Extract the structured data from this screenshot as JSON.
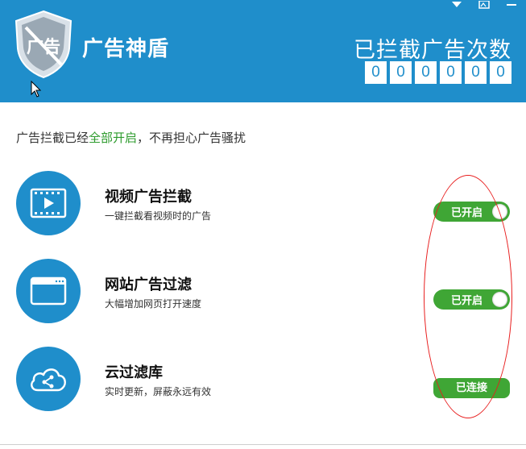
{
  "header": {
    "logo_text": "广告",
    "title": "广告神盾",
    "counter_label": "已拦截广告次数",
    "counter_digits": [
      "0",
      "0",
      "0",
      "0",
      "0",
      "0"
    ],
    "background_color": "#1f8ecb"
  },
  "window_controls": {
    "icons": [
      "chevron-down-icon",
      "skin-icon",
      "minimize-icon"
    ]
  },
  "status": {
    "prefix": "广告拦截已经",
    "highlight": "全部开启",
    "suffix": "，不再担心广告骚扰",
    "highlight_color": "#2d9b2d"
  },
  "features": [
    {
      "icon": "video-icon",
      "title": "视频广告拦截",
      "desc": "一键拦截看视频时的广告",
      "control": "toggle",
      "control_label": "已开启"
    },
    {
      "icon": "browser-window-icon",
      "title": "网站广告过滤",
      "desc": "大幅增加网页打开速度",
      "control": "toggle",
      "control_label": "已开启"
    },
    {
      "icon": "cloud-share-icon",
      "title": "云过滤库",
      "desc": "实时更新，屏蔽永远有效",
      "control": "button",
      "control_label": "已连接"
    }
  ],
  "colors": {
    "toggle_green": "#3fa635",
    "annotation_red": "#e81e1e"
  }
}
